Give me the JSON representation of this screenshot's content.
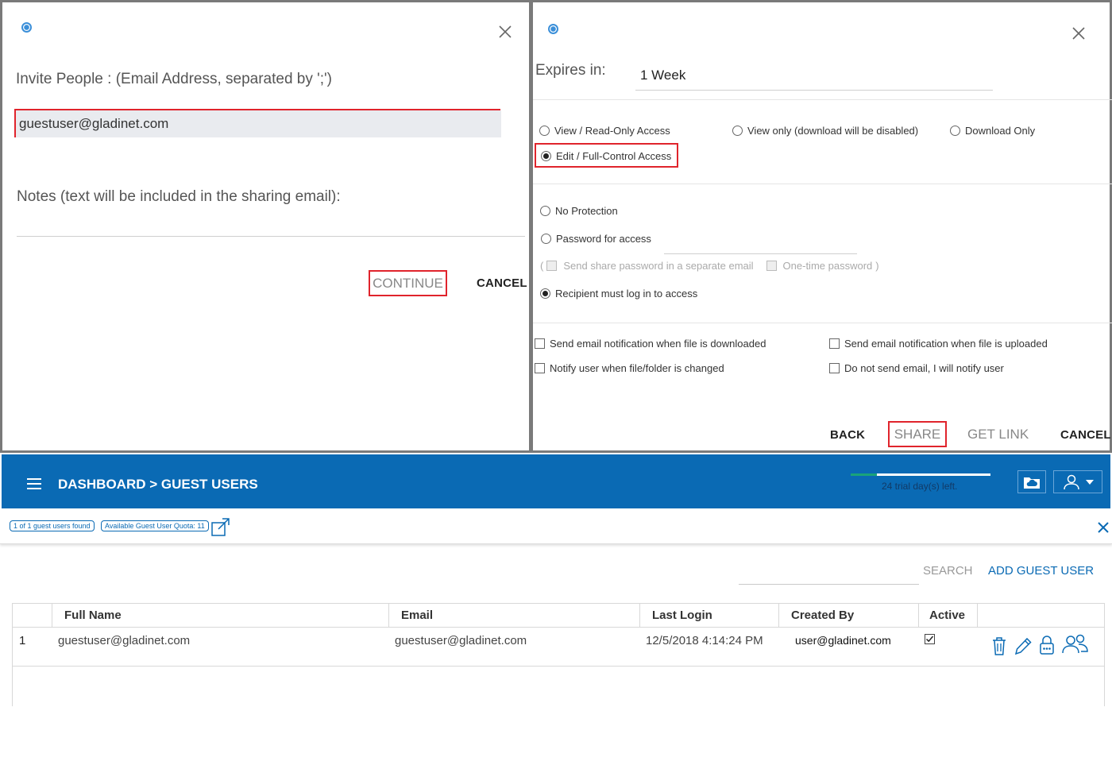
{
  "invite_dialog": {
    "label": "Invite People : (Email Address, separated by ';')",
    "email_value": "guestuser@gladinet.com",
    "notes_label": "Notes (text will be included in the sharing email):",
    "continue_label": "CONTINUE",
    "cancel_label": "CANCEL"
  },
  "share_dialog": {
    "expires_label": "Expires in:",
    "expires_value": "1 Week",
    "access_options": [
      {
        "label": "View / Read-Only Access",
        "selected": false
      },
      {
        "label": "View only (download will be disabled)",
        "selected": false
      },
      {
        "label": "Download Only",
        "selected": false
      },
      {
        "label": "Edit / Full-Control Access",
        "selected": true
      }
    ],
    "protection": {
      "no_protection": "No Protection",
      "password_for_access": "Password for access",
      "paren_open": "(",
      "send_password_separate": "Send share password in a separate email",
      "one_time_password": "One-time password",
      "paren_close": ")",
      "recipient_login": "Recipient must log in to access"
    },
    "notifications": {
      "email_on_download": "Send email notification when file is downloaded",
      "email_on_upload": "Send email notification when file is uploaded",
      "notify_on_change": "Notify user when file/folder is changed",
      "no_email": "Do not send email, I will notify user"
    },
    "buttons": {
      "back": "BACK",
      "share": "SHARE",
      "get_link": "GET LINK",
      "cancel": "CANCEL"
    }
  },
  "dashboard": {
    "breadcrumb": "DASHBOARD > GUEST USERS",
    "trial_text": "24 trial day(s) left.",
    "trial_progress": 0.19,
    "badges": {
      "found": "1 of 1 guest users found",
      "quota": "Available Guest User Quota: 11"
    },
    "search_label": "SEARCH",
    "add_guest_label": "ADD GUEST USER",
    "table": {
      "columns": [
        "Full Name",
        "Email",
        "Last Login",
        "Created By",
        "Active"
      ],
      "rows": [
        {
          "index": "1",
          "full_name": "guestuser@gladinet.com",
          "email": "guestuser@gladinet.com",
          "last_login": "12/5/2018 4:14:24 PM",
          "created_by": "user@gladinet.com",
          "active": true
        }
      ]
    }
  },
  "colors": {
    "brand_blue": "#0a6ab4",
    "highlight_red": "#e0242c",
    "progress_green": "#1aa37a"
  }
}
